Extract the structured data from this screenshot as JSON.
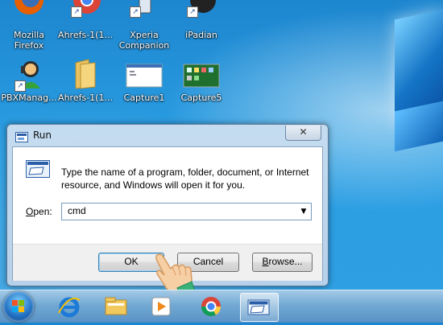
{
  "desktop": {
    "icons": [
      {
        "label_line1": "Mozilla",
        "label_line2": "Firefox",
        "icon": "firefox-icon"
      },
      {
        "label_line1": "Ahrefs-1(1...",
        "label_line2": "",
        "icon": "chrome-shortcut-icon"
      },
      {
        "label_line1": "Xperia",
        "label_line2": "Companion",
        "icon": "xperia-companion-icon"
      },
      {
        "label_line1": "iPadian",
        "label_line2": "",
        "icon": "ipadian-icon"
      },
      {
        "label_line1": "PBXManag...",
        "label_line2": "",
        "icon": "pbx-manager-icon"
      },
      {
        "label_line1": "Ahrefs-1(1...",
        "label_line2": "",
        "icon": "folder-icon"
      },
      {
        "label_line1": "Capture1",
        "label_line2": "",
        "icon": "image-file-icon"
      },
      {
        "label_line1": "Capture5",
        "label_line2": "",
        "icon": "image-file-icon"
      }
    ]
  },
  "run_dialog": {
    "title": "Run",
    "close_glyph": "✕",
    "description": "Type the name of a program, folder, document, or Internet resource, and Windows will open it for you.",
    "open_label_prefix": "O",
    "open_label_rest": "pen:",
    "open_value": "cmd",
    "dropdown_glyph": "▼",
    "ok_label": "OK",
    "cancel_label": "Cancel",
    "browse_label_prefix": "B",
    "browse_label_rest": "rowse..."
  },
  "taskbar": {
    "items": [
      {
        "icon": "internet-explorer-icon"
      },
      {
        "icon": "file-explorer-icon"
      },
      {
        "icon": "media-player-icon"
      },
      {
        "icon": "chrome-icon"
      },
      {
        "icon": "run-icon",
        "active": true
      }
    ]
  },
  "colors": {
    "desktop_blue": "#2a9ee3",
    "dialog_frame": "#b7d1ea",
    "ok_focus": "#3c7fb1"
  }
}
